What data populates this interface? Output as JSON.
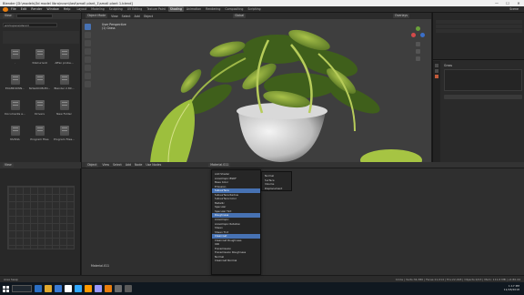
{
  "window": {
    "title": "Blender [D:\\models\\3d model libra\\ncsm\\last\\small plant_1\\small plant 1.blend]",
    "min": "—",
    "max": "☐",
    "close": "✕"
  },
  "topbar": {
    "menus": [
      "File",
      "Edit",
      "Render",
      "Window",
      "Help"
    ],
    "tabs": [
      "Layout",
      "Modeling",
      "Sculpting",
      "UV Editing",
      "Texture Paint",
      "Shading",
      "Animation",
      "Rendering",
      "Compositing",
      "Scripting"
    ],
    "active_tab": "Shading",
    "scene": "Scene"
  },
  "filebrowser": {
    "view": "View",
    "path": "workspace/stencil",
    "files": [
      {
        "name": ".."
      },
      {
        "name": "3dsCurrent"
      },
      {
        "name": "Affan probe..."
      },
      {
        "name": "EXAMDOWN..."
      },
      {
        "name": "N2lazOCMLE0..."
      },
      {
        "name": "Blender 2.80..."
      },
      {
        "name": "Documents a..."
      },
      {
        "name": "Drivers"
      },
      {
        "name": "New Folder"
      },
      {
        "name": "NVIDIA"
      },
      {
        "name": "Program Files"
      },
      {
        "name": "Program Files..."
      }
    ]
  },
  "viewport": {
    "mode": "Object Mode",
    "menu": [
      "View",
      "Select",
      "Add",
      "Object"
    ],
    "transform": "Global",
    "info_line1": "User Perspective",
    "info_line2": "(1) Grass",
    "overlays": "Overlays"
  },
  "properties": {
    "object_name": "Grass",
    "material_slot": "Slot"
  },
  "shader_editor": {
    "object_label": "Object",
    "menu": [
      "View",
      "Select",
      "Add",
      "Node"
    ],
    "use_nodes": "Use Nodes",
    "material": "Material.011",
    "slot": "Slot",
    "node_label": "Material.011"
  },
  "shader_menu": {
    "items": [
      "Add Shader",
      "Anisotropic BSDF",
      "Base Color",
      "Emission",
      "Subsurface",
      "Subsurface Radius",
      "Subsurface Color",
      "Metallic",
      "Specular",
      "Specular Tint",
      "Roughness",
      "Anisotropic",
      "Anisotropic Rotation",
      "Sheen",
      "Sheen Tint",
      "Clearcoat",
      "Clearcoat Roughness",
      "IOR",
      "Transmission",
      "Transmission Roughness",
      "Normal",
      "Clearcoat Normal"
    ],
    "highlighted": [
      4,
      10,
      15
    ]
  },
  "submenu": {
    "items": [
      "Normal",
      "Surface",
      "Volume",
      "Displacement"
    ]
  },
  "bottom_left": {
    "view": "View"
  },
  "statusbar": {
    "left": "Area Swap",
    "right": "Circle | Verts:34,380 | Faces:11,014 | Tris:22,018 | Objects:0/13 | Mem: 111.6 MB | v2.80.44"
  },
  "taskbar": {
    "time": "1:17 PM",
    "date": "11/18/2018"
  },
  "colors": {
    "accent": "#4772b3",
    "blender_orange": "#e87d0d"
  }
}
